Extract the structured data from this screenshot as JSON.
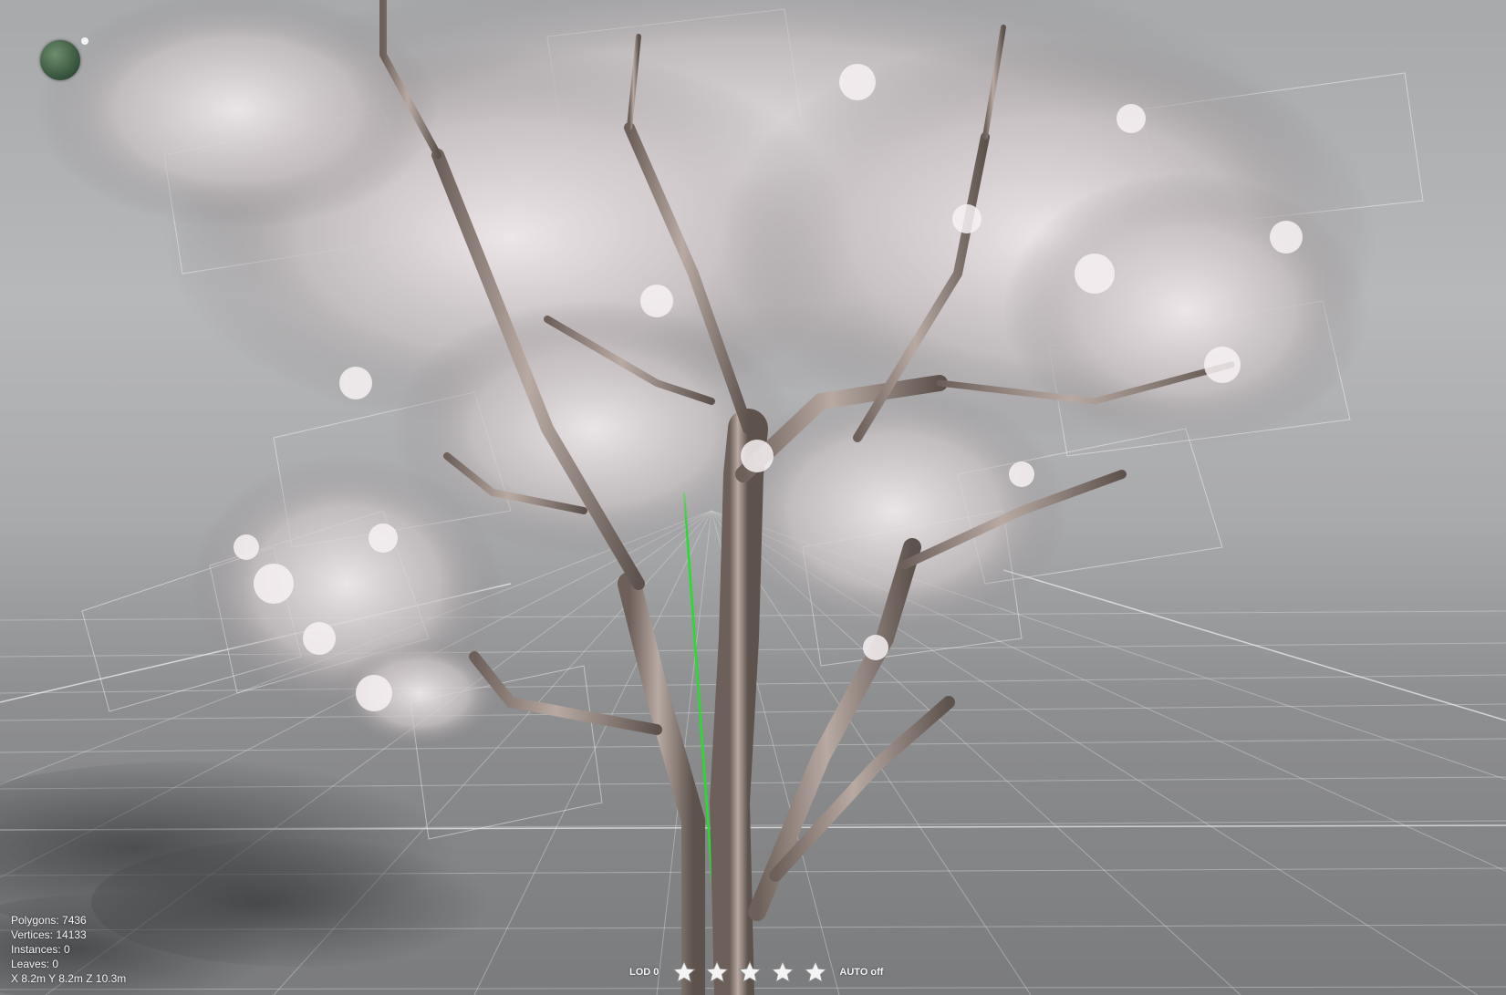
{
  "stats": {
    "polygons": "Polygons: 7436",
    "vertices": "Vertices: 14133",
    "instances": "Instances: 0",
    "leaves": "Leaves: 0",
    "dimensions": "X 8.2m Y 8.2m Z 10.3m"
  },
  "lod_bar": {
    "lod_label": "LOD 0",
    "star_count": 5,
    "auto_label": "AUTO off"
  },
  "colors": {
    "axis_green": "#22e02a",
    "grid_line": "#d9d9d9",
    "overlay_text": "#f2f2f2"
  },
  "icons": {
    "orientation_gizmo": "sphere-icon",
    "lod_stars": "star-icon"
  }
}
